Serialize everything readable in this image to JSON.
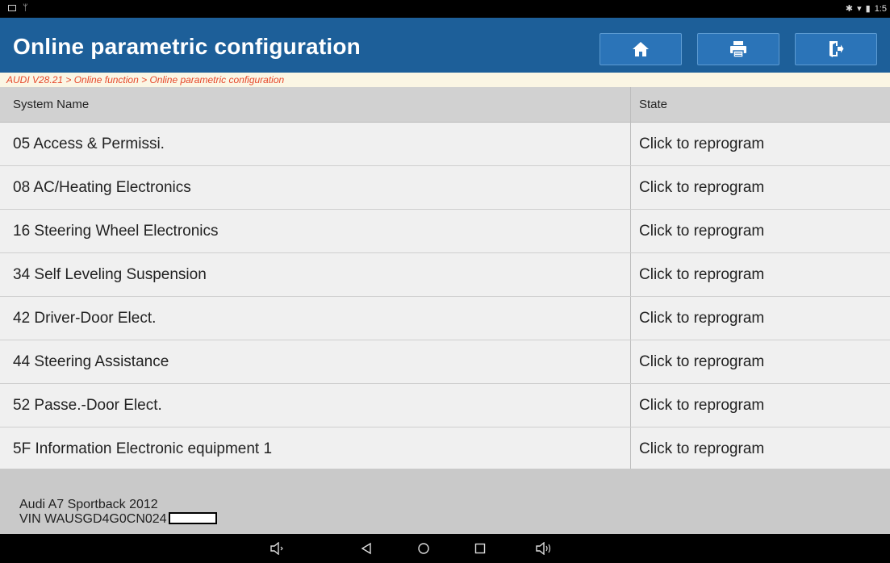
{
  "status_bar": {
    "time": "1:5"
  },
  "header": {
    "title": "Online parametric configuration",
    "buttons": {
      "home": "home-icon",
      "print": "print-icon",
      "exit": "exit-icon"
    }
  },
  "breadcrumb": "AUDI V28.21 > Online function > Online parametric configuration",
  "table": {
    "headers": {
      "name": "System Name",
      "state": "State"
    },
    "rows": [
      {
        "name": "05 Access & Permissi.",
        "state": "Click to reprogram"
      },
      {
        "name": "08 AC/Heating Electronics",
        "state": "Click to reprogram"
      },
      {
        "name": "16 Steering Wheel Electronics",
        "state": "Click to reprogram"
      },
      {
        "name": "34 Self Leveling Suspension",
        "state": "Click to reprogram"
      },
      {
        "name": "42 Driver-Door Elect.",
        "state": "Click to reprogram"
      },
      {
        "name": "44 Steering Assistance",
        "state": "Click to reprogram"
      },
      {
        "name": "52 Passe.-Door Elect.",
        "state": "Click to reprogram"
      },
      {
        "name": "5F Information Electronic equipment 1",
        "state": "Click to reprogram"
      }
    ]
  },
  "footer": {
    "vehicle": "Audi A7 Sportback 2012",
    "vin": "VIN WAUSGD4G0CN024"
  },
  "colors": {
    "header_bg": "#1d5f99",
    "button_bg": "#2b74b8",
    "breadcrumb_text": "#e6472a",
    "breadcrumb_bg": "#fbf6e4"
  }
}
